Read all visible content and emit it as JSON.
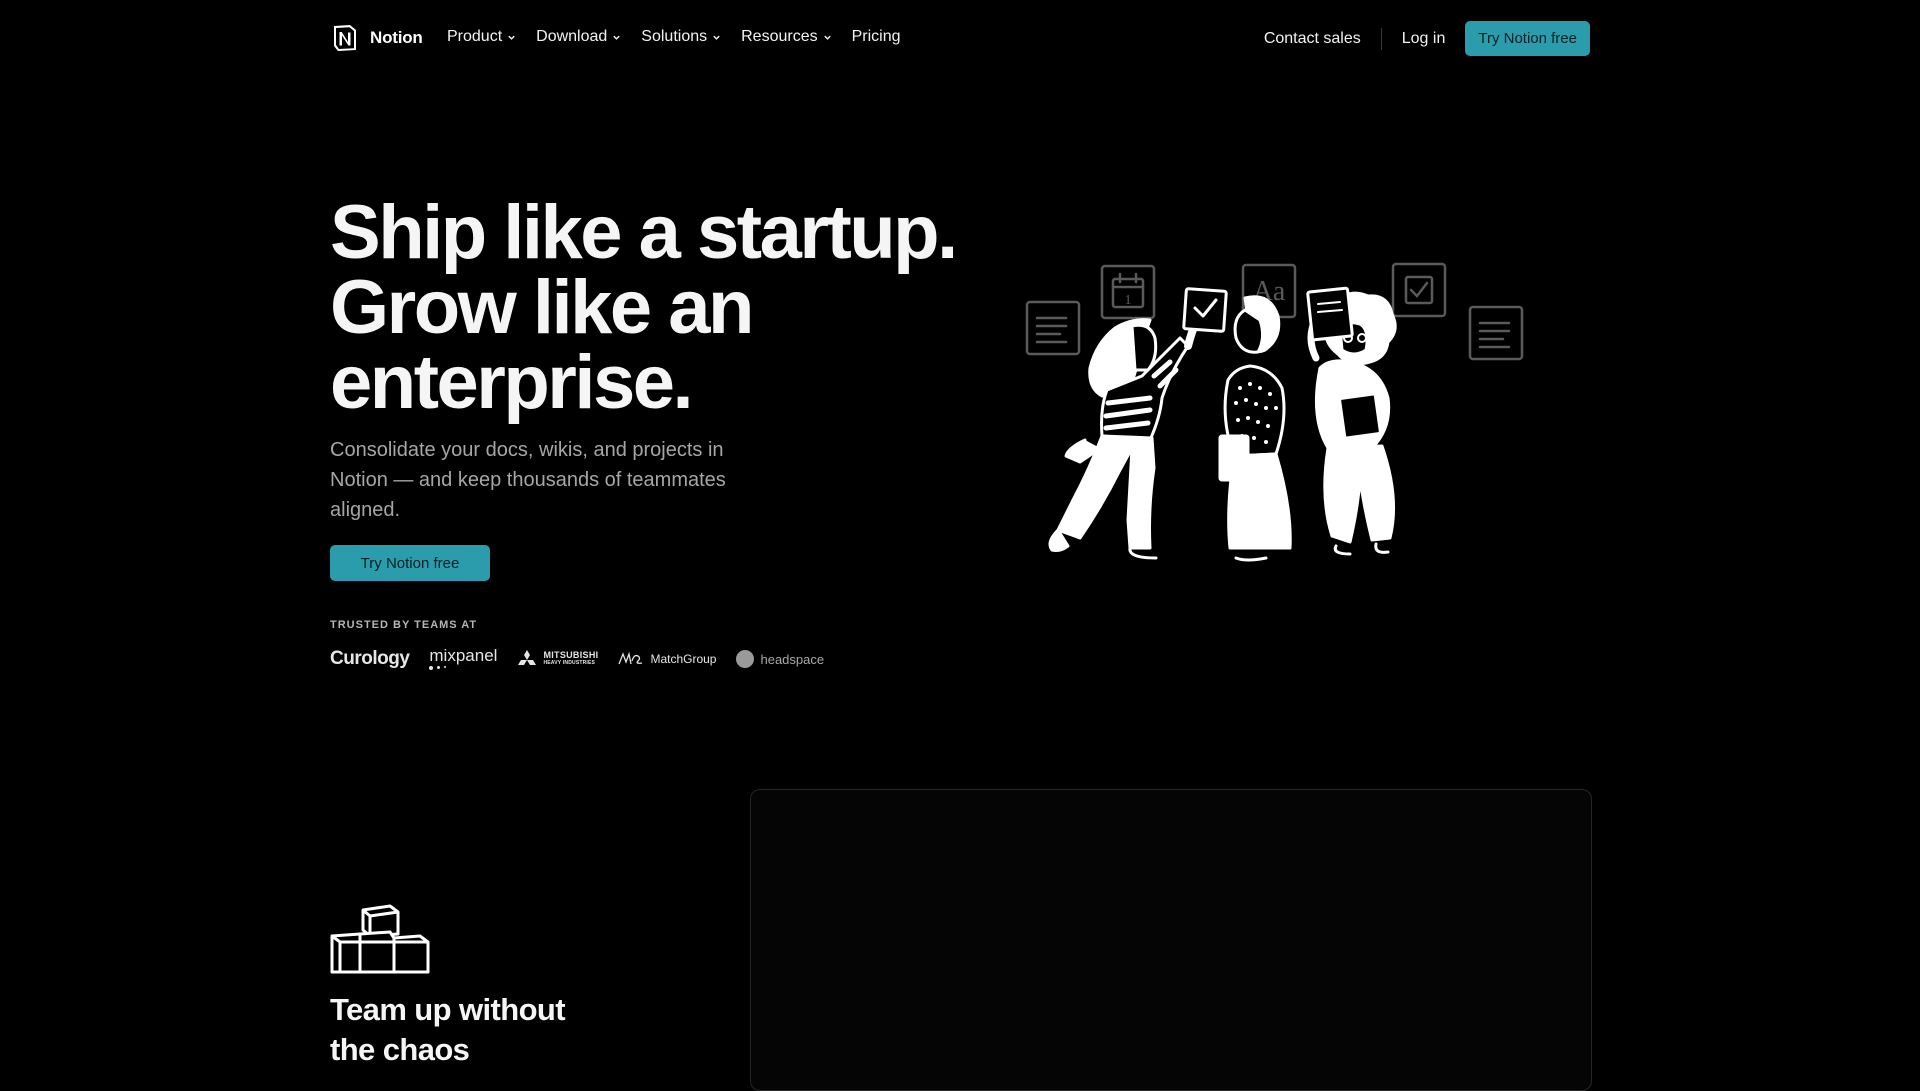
{
  "nav": {
    "brand": "Notion",
    "menu": [
      {
        "label": "Product",
        "dropdown": true
      },
      {
        "label": "Download",
        "dropdown": true
      },
      {
        "label": "Solutions",
        "dropdown": true
      },
      {
        "label": "Resources",
        "dropdown": true
      },
      {
        "label": "Pricing",
        "dropdown": false
      }
    ],
    "contact_sales": "Contact sales",
    "log_in": "Log in",
    "cta": "Try Notion free"
  },
  "hero": {
    "title_lines": [
      "Ship like a startup.",
      "Grow like an",
      "enterprise."
    ],
    "subtitle": "Consolidate your docs, wikis, and projects in Notion — and keep thousands of teammates aligned.",
    "cta": "Try Notion free",
    "trusted_label": "TRUSTED BY TEAMS AT",
    "logos": {
      "curology": "Curology",
      "mixpanel": "mixpanel",
      "mitsubishi": "MITSUBISHI",
      "mitsubishi_sub": "HEAVY INDUSTRIES",
      "match": "MatchGroup",
      "headspace": "headspace"
    },
    "illustration_card_text": "Aa",
    "illustration_calendar_day": "1"
  },
  "section": {
    "icon": "cubes-icon",
    "title_lines": [
      "Team up without",
      "the chaos"
    ]
  },
  "colors": {
    "background": "#000000",
    "accent": "#2a9cab",
    "text_primary": "#f5f5f5",
    "text_muted": "#a6a6a6"
  }
}
